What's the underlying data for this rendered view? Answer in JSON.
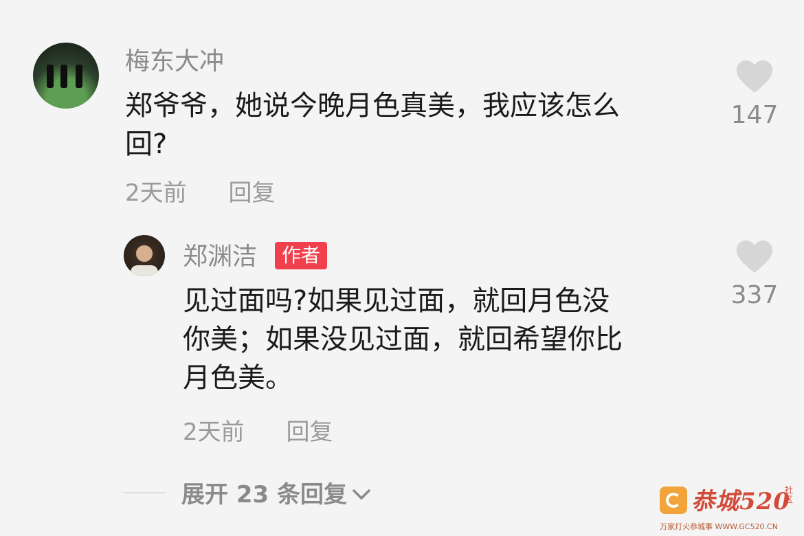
{
  "comment": {
    "username": "梅东大冲",
    "text_line1": "郑爷爷，她说今晚月色真美，我应该怎么",
    "text_line2": "回?",
    "time": "2天前",
    "reply_label": "回复",
    "likes": "147"
  },
  "reply": {
    "username": "郑渊洁",
    "badge": "作者",
    "text_line1": "见过面吗?如果见过面，就回月色没",
    "text_line2": "你美；如果没见过面，就回希望你比",
    "text_line3": "月色美。",
    "time": "2天前",
    "reply_label": "回复",
    "likes": "337"
  },
  "expand_label": "展开 23 条回复",
  "watermark": {
    "brand": "恭城520",
    "side": "社区",
    "tagline": "万家灯火恭城事 WWW.GC520.CN"
  },
  "colors": {
    "background": "#f4f4f4",
    "badge": "#f0404d",
    "heart": "#d6d6d6"
  }
}
